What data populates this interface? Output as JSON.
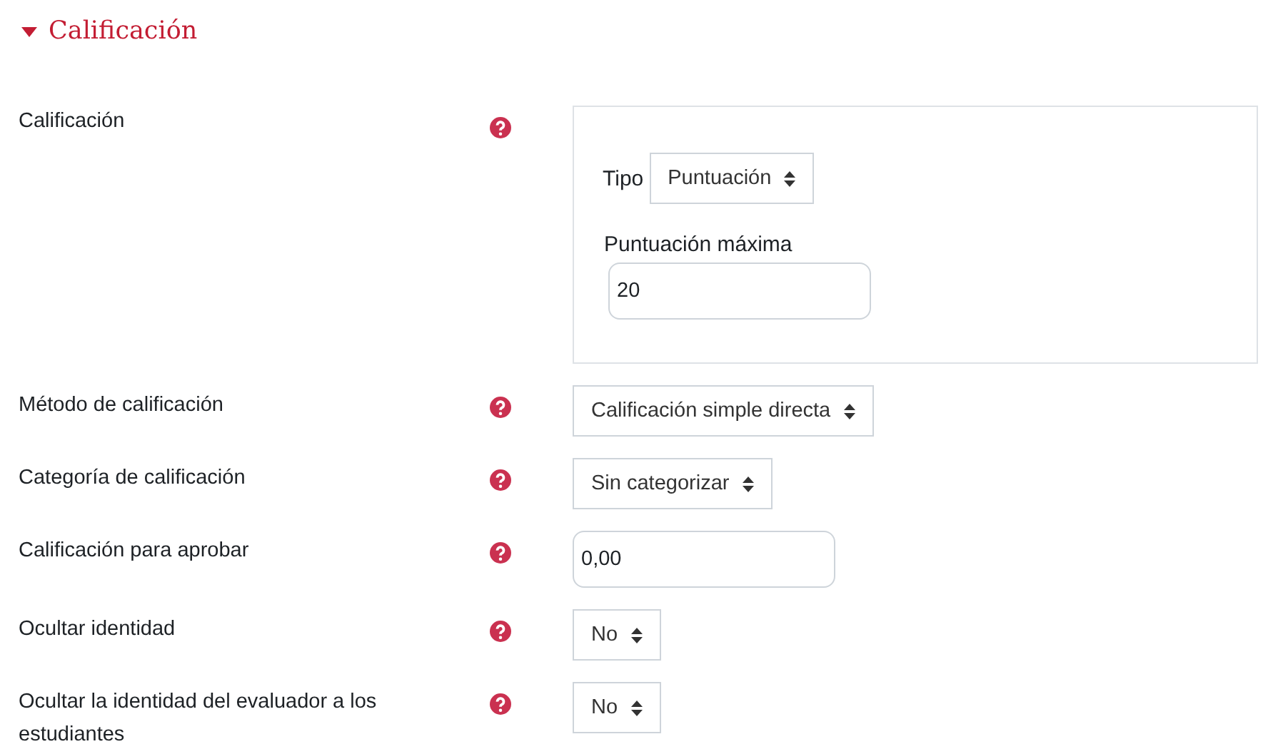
{
  "section": {
    "title": "Calificación",
    "expanded": true
  },
  "fields": [
    {
      "label": "Calificación",
      "kind": "group",
      "items": [
        {
          "kind": "select",
          "label": "Tipo",
          "value": "Puntuación"
        },
        {
          "kind": "input",
          "label": "Puntuación máxima",
          "value": "20"
        }
      ]
    },
    {
      "label": "Método de calificación",
      "kind": "select",
      "value": "Calificación simple directa"
    },
    {
      "label": "Categoría de calificación",
      "kind": "select",
      "value": "Sin categorizar"
    },
    {
      "label": "Calificación para aprobar",
      "kind": "input",
      "value": "0,00"
    },
    {
      "label": "Ocultar identidad",
      "kind": "select",
      "value": "No"
    },
    {
      "label": "Ocultar la identidad del evaluador a los estudiantes",
      "kind": "select",
      "value": "No"
    }
  ]
}
